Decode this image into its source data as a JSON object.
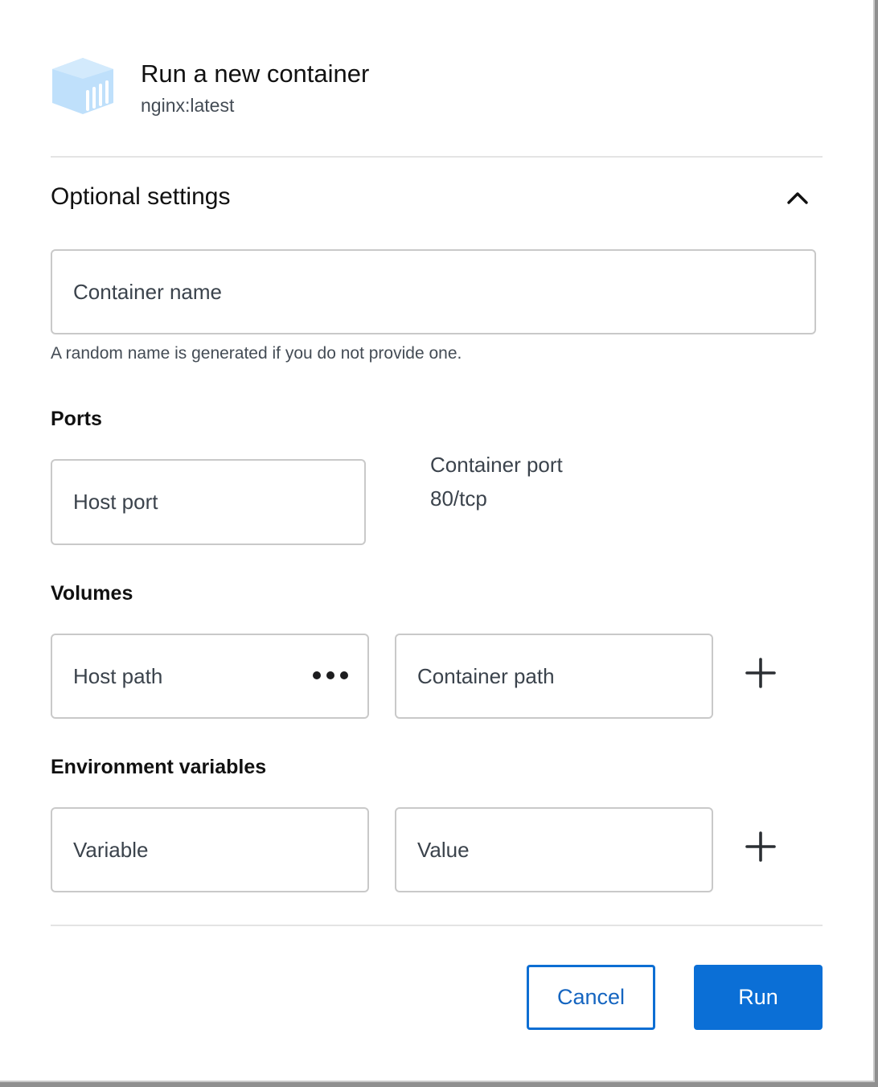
{
  "dialog": {
    "title": "Run a new container",
    "subtitle": "nginx:latest",
    "logo_icon": "container-box-icon"
  },
  "optional_settings": {
    "label": "Optional settings",
    "expanded": true,
    "toggle_icon": "chevron-up-icon"
  },
  "container_name": {
    "placeholder": "Container name",
    "value": "",
    "hint": "A random name is generated if you do not provide one."
  },
  "ports": {
    "title": "Ports",
    "host_port_placeholder": "Host port",
    "host_port_value": "",
    "container_port_label": "Container port",
    "container_port_value": "80/tcp"
  },
  "volumes": {
    "title": "Volumes",
    "host_path_placeholder": "Host path",
    "container_path_placeholder": "Container path",
    "browse_icon": "more-horizontal-icon",
    "add_icon": "plus-icon"
  },
  "env": {
    "title": "Environment variables",
    "variable_placeholder": "Variable",
    "value_placeholder": "Value",
    "add_icon": "plus-icon"
  },
  "actions": {
    "cancel_label": "Cancel",
    "run_label": "Run"
  },
  "colors": {
    "primary": "#0b6fd6",
    "logo": "#bfe0fb"
  }
}
